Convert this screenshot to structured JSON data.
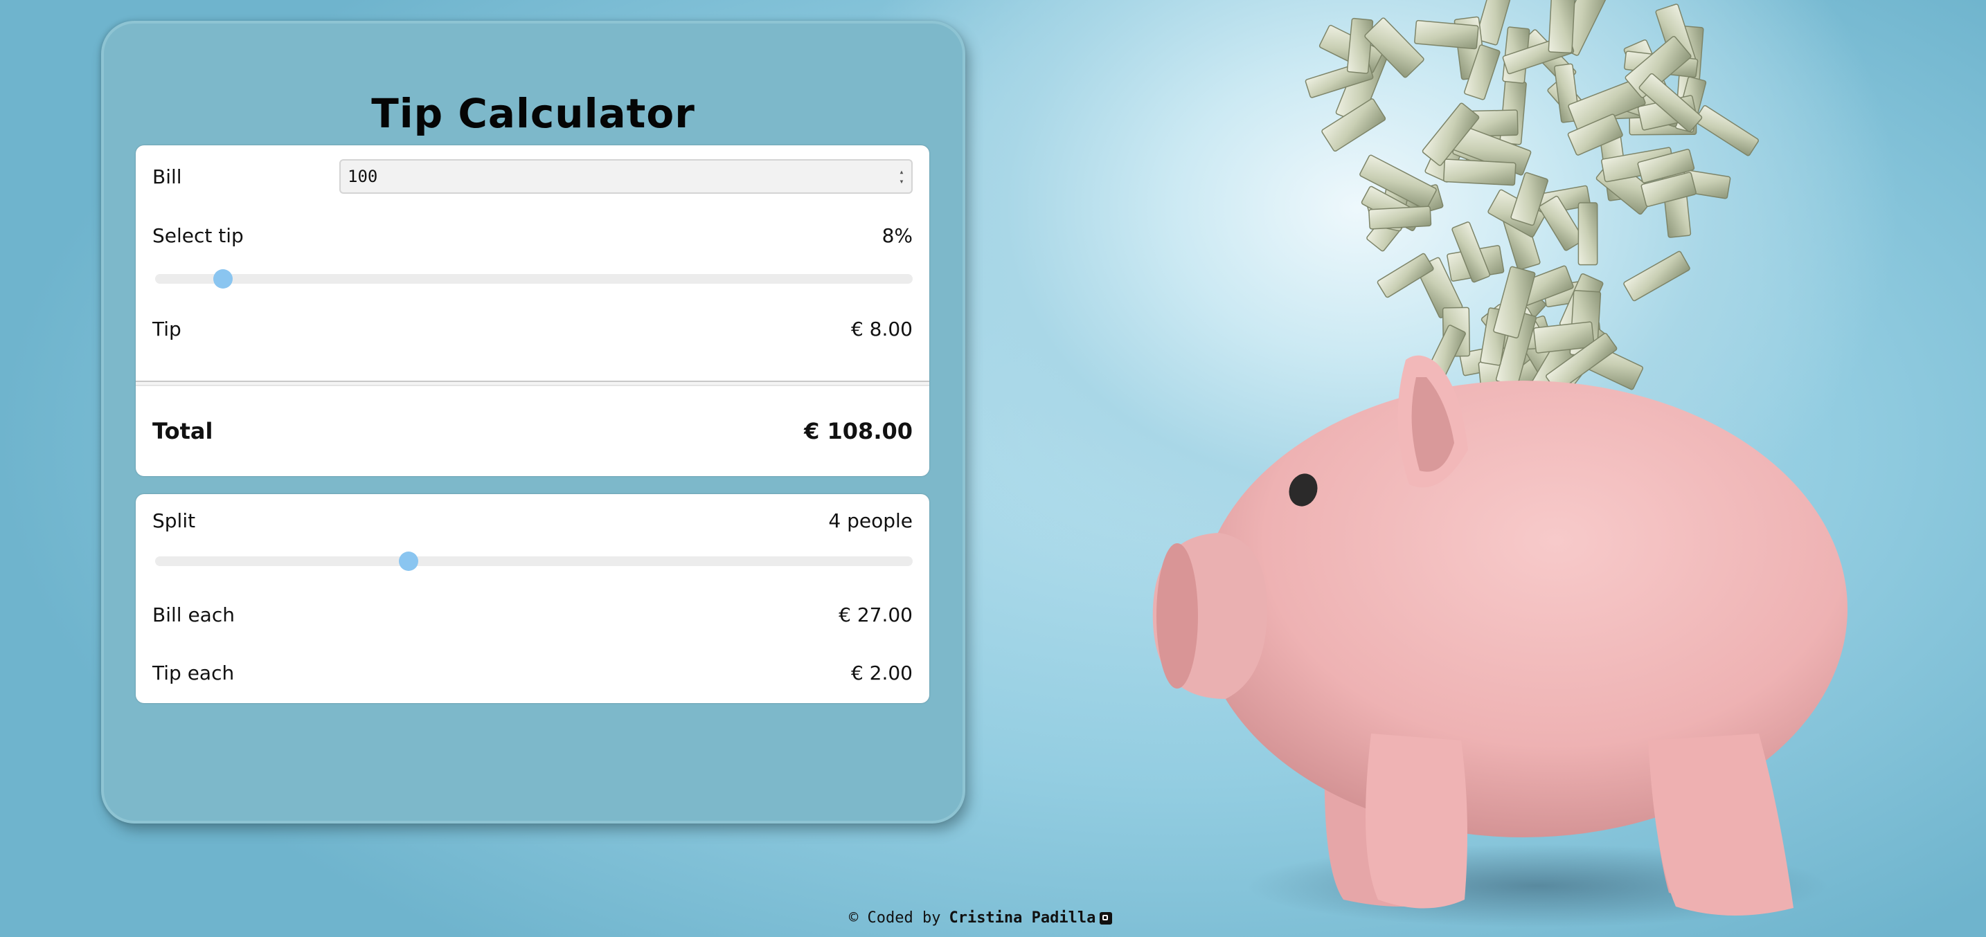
{
  "app": {
    "title": "Tip Calculator"
  },
  "bill": {
    "label": "Bill",
    "value": "100"
  },
  "tip_select": {
    "label": "Select tip",
    "value_text": "8%",
    "slider_fraction": 0.09
  },
  "tip_amount": {
    "label": "Tip",
    "value": "€ 8.00"
  },
  "total": {
    "label": "Total",
    "value": "€ 108.00"
  },
  "split": {
    "label": "Split",
    "value_text": "4 people",
    "slider_fraction": 0.335
  },
  "bill_each": {
    "label": "Bill each",
    "value": "€ 27.00"
  },
  "tip_each": {
    "label": "Tip each",
    "value": "€ 2.00"
  },
  "footer": {
    "prefix": "© Coded by",
    "author": "Cristina Padilla",
    "link_icon": "external-link-icon"
  },
  "colors": {
    "panel": "#7db8ca",
    "slider_thumb": "#8ac5f0",
    "piggy": "#f0b5b5",
    "background": "#93cde1"
  },
  "illustration": {
    "icon": "piggy-bank-with-flying-banknotes"
  }
}
